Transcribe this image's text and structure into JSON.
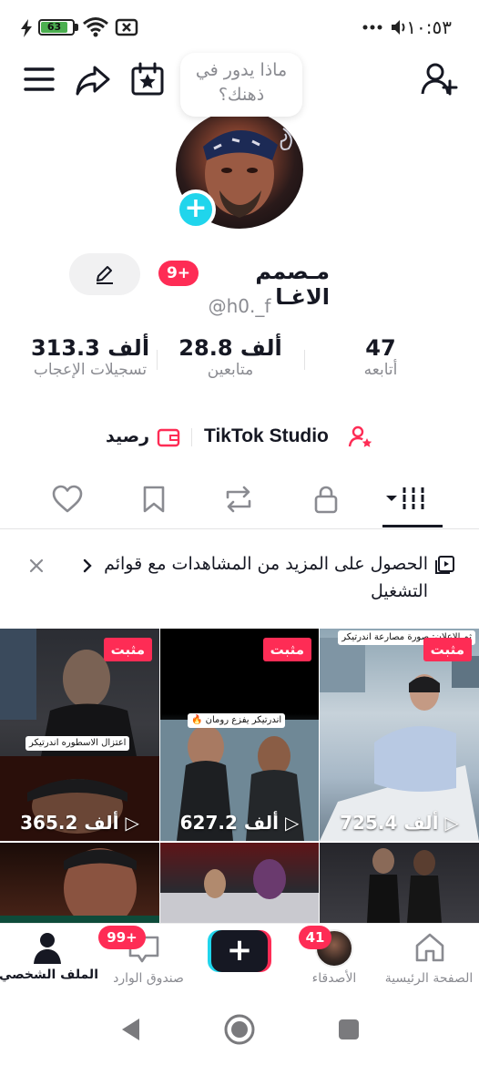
{
  "status_bar": {
    "battery_level": "63",
    "time": "١٠:٥٣",
    "icons": [
      "charging-bolt-icon",
      "battery-icon",
      "wifi-icon",
      "no-sim-icon",
      "more-dots-icon",
      "volume-icon"
    ]
  },
  "header": {
    "thought_bubble": "ماذا يدور في ذهنك؟",
    "icons": [
      "add-user-icon",
      "calendar-star-icon",
      "share-icon",
      "menu-icon"
    ]
  },
  "profile": {
    "name": "مـصمم الاغـا",
    "notification_badge": "9+",
    "handle": "@h0._f"
  },
  "stats": [
    {
      "value": "47",
      "label": "أتابعه"
    },
    {
      "value": "28.8",
      "unit": "ألف",
      "label": "متابعين"
    },
    {
      "value": "313.3",
      "unit": "ألف",
      "label": "تسجيلات الإعجاب"
    }
  ],
  "tools": {
    "studio": "TikTok Studio",
    "balance": "رصيد"
  },
  "tabs": [
    "videos-grid-icon",
    "lock-icon",
    "repost-icon",
    "bookmark-icon",
    "heart-icon"
  ],
  "playlist_banner": {
    "text": "الحصول على المزيد من المشاهدات مع قوائم التشغيل"
  },
  "videos": [
    {
      "pinned": "مثبت",
      "views": "725.4",
      "unit": "ألف",
      "caption": "ثم الإعلان: صورة مصارعة اندرتيكر"
    },
    {
      "pinned": "مثبت",
      "views": "627.2",
      "unit": "ألف",
      "caption": "اندرتيكر يفزع رومان 🔥"
    },
    {
      "pinned": "مثبت",
      "views": "365.2",
      "unit": "ألف",
      "caption": "اعتزال الاسطوره اندرتيكر"
    },
    {
      "pinned": "",
      "views": "",
      "unit": "",
      "caption": ""
    },
    {
      "pinned": "",
      "views": "",
      "unit": "",
      "caption": ""
    },
    {
      "pinned": "",
      "views": "",
      "unit": "",
      "caption": ""
    }
  ],
  "bottom_nav": [
    {
      "label": "الصفحة الرئيسية",
      "badge": ""
    },
    {
      "label": "الأصدقاء",
      "badge": "41"
    },
    {
      "label": "",
      "badge": ""
    },
    {
      "label": "صندوق الوارد",
      "badge": "99+"
    },
    {
      "label": "الملف الشخصي",
      "badge": ""
    }
  ],
  "colors": {
    "accent": "#fe2c55",
    "cyan": "#20d5ec",
    "text": "#161823",
    "muted": "#8a8b91"
  }
}
